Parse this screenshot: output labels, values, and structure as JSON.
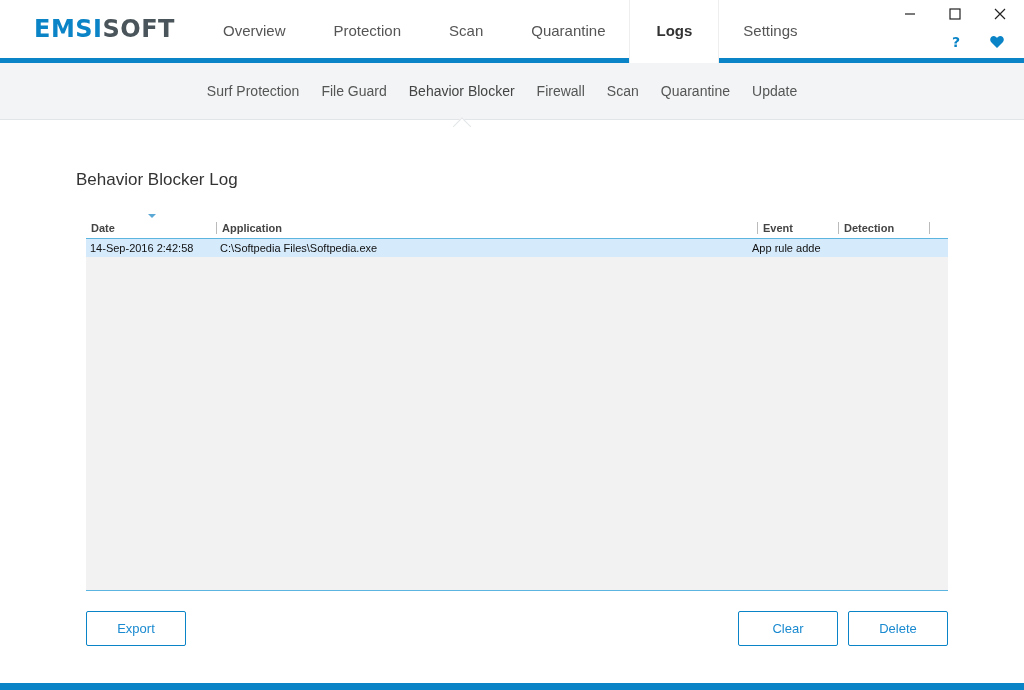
{
  "logo": {
    "accent": "EMSI",
    "rest": "SOFT"
  },
  "tabs": [
    {
      "label": "Overview",
      "selected": false
    },
    {
      "label": "Protection",
      "selected": false
    },
    {
      "label": "Scan",
      "selected": false
    },
    {
      "label": "Quarantine",
      "selected": false
    },
    {
      "label": "Logs",
      "selected": true
    },
    {
      "label": "Settings",
      "selected": false
    }
  ],
  "help": "?",
  "subtabs": [
    {
      "label": "Surf Protection",
      "selected": false
    },
    {
      "label": "File Guard",
      "selected": false
    },
    {
      "label": "Behavior Blocker",
      "selected": true
    },
    {
      "label": "Firewall",
      "selected": false
    },
    {
      "label": "Scan",
      "selected": false
    },
    {
      "label": "Quarantine",
      "selected": false
    },
    {
      "label": "Update",
      "selected": false
    }
  ],
  "log_title": "Behavior Blocker Log",
  "table": {
    "columns": [
      "Date",
      "Application",
      "Event",
      "Detection"
    ],
    "rows": [
      {
        "cells": [
          "14-Sep-2016 2:42:58",
          "C:\\Softpedia Files\\Softpedia.exe",
          "App rule adde",
          ""
        ],
        "selected": true
      }
    ]
  },
  "buttons": {
    "left": [
      "Export"
    ],
    "right": [
      "Clear",
      "Delete"
    ]
  }
}
